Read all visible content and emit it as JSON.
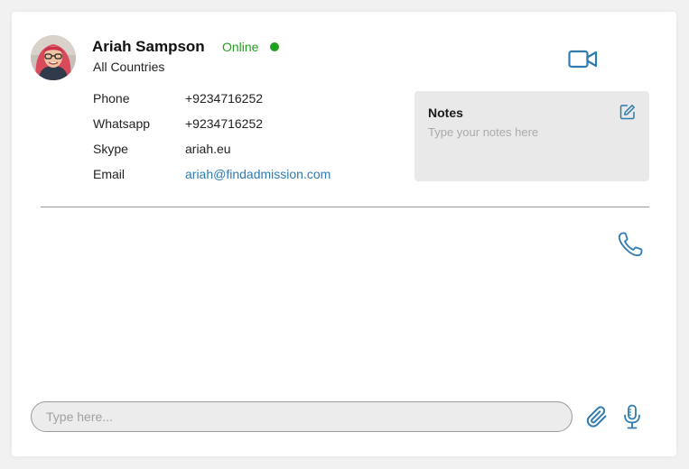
{
  "contact": {
    "name": "Ariah Sampson",
    "status": "Online",
    "subtitle": "All Countries",
    "avatar_alt": "avatar"
  },
  "details": [
    {
      "label": "Phone",
      "value": "+9234716252"
    },
    {
      "label": "Whatsapp",
      "value": "+9234716252"
    },
    {
      "label": "Skype",
      "value": "ariah.eu"
    },
    {
      "label": "Email",
      "value": "ariah@findadmission.com"
    }
  ],
  "notes": {
    "title": "Notes",
    "placeholder": "Type your notes here"
  },
  "composer": {
    "placeholder": "Type here...",
    "value": ""
  },
  "icons": {
    "video": "video-camera-icon",
    "edit": "edit-icon",
    "phone": "phone-icon",
    "attach": "paperclip-icon",
    "mic": "microphone-icon"
  },
  "colors": {
    "accent": "#2e7bb0",
    "online": "#1ea11e",
    "status_text": "#22a022",
    "notes_bg": "#e9e9e9"
  }
}
